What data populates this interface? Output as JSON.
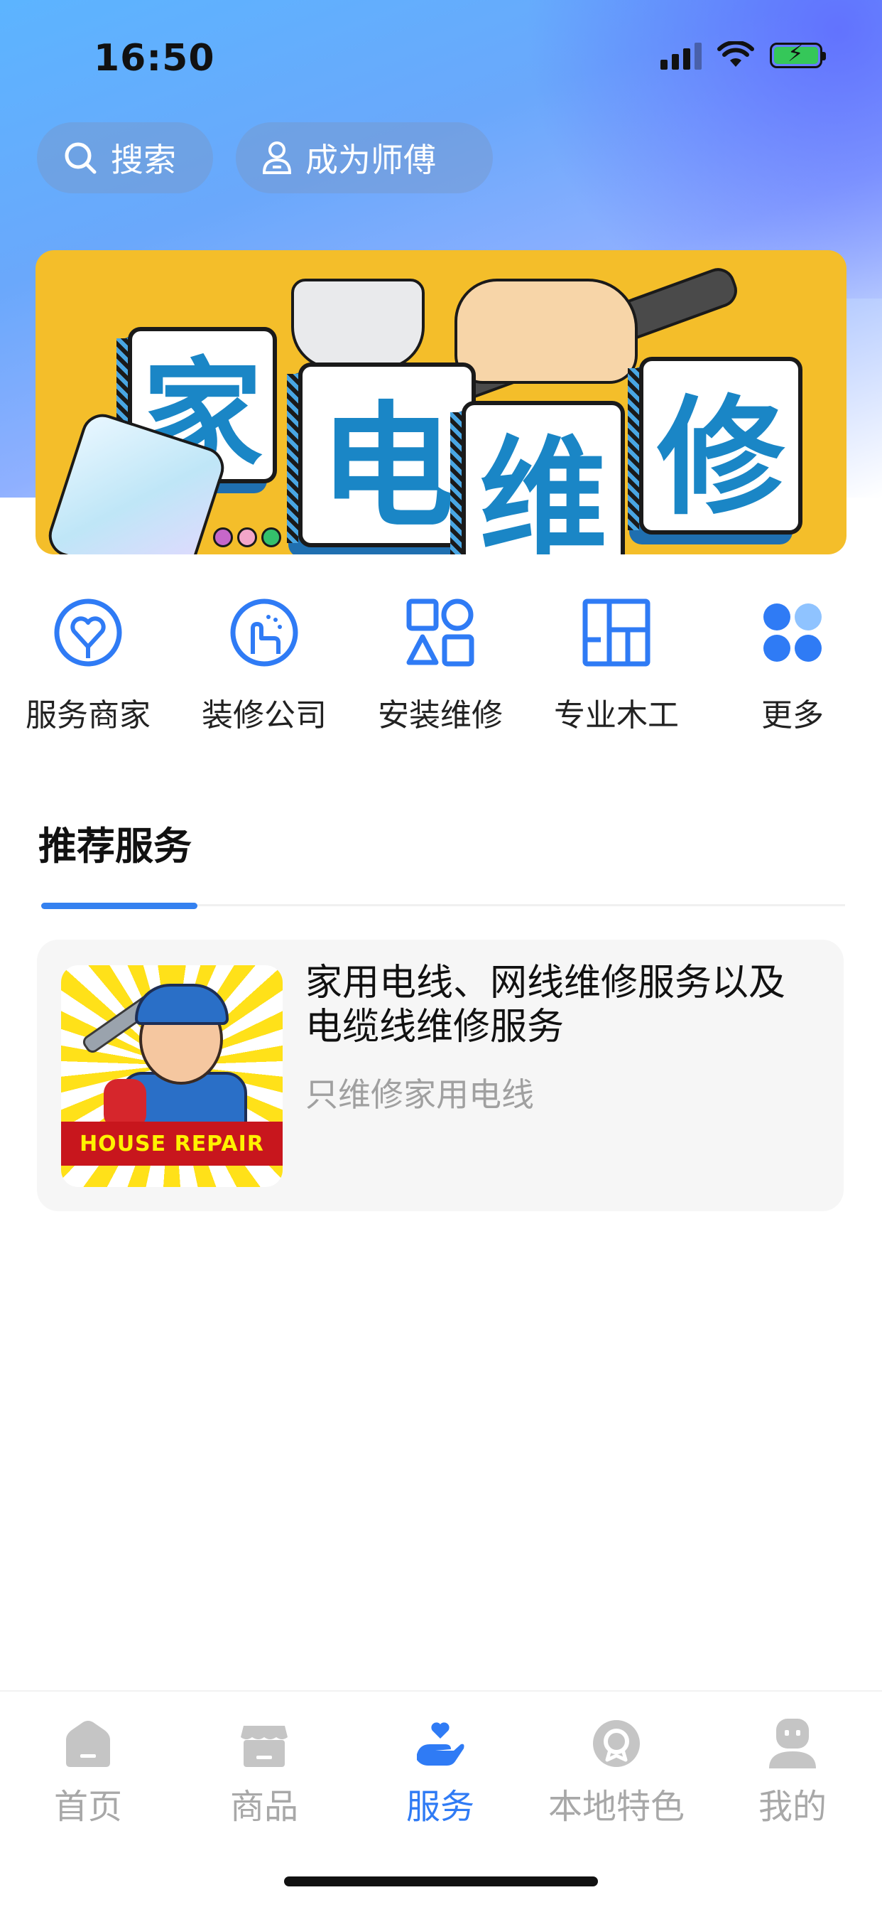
{
  "status_bar": {
    "time": "16:50"
  },
  "top_buttons": {
    "search_label": "搜索",
    "become_master_label": "成为师傅"
  },
  "banner": {
    "chars": [
      "家",
      "电",
      "维",
      "修"
    ]
  },
  "categories": [
    {
      "label": "服务商家",
      "icon": "merchant-heart-icon"
    },
    {
      "label": "装修公司",
      "icon": "renovation-hand-icon"
    },
    {
      "label": "安装维修",
      "icon": "shapes-grid-icon"
    },
    {
      "label": "专业木工",
      "icon": "floorplan-icon"
    },
    {
      "label": "更多",
      "icon": "more-clover-icon"
    }
  ],
  "section": {
    "title": "推荐服务"
  },
  "service_card": {
    "title": "家用电线、网线维修服务以及电缆线维修服务",
    "subtitle": "只维修家用电线",
    "thumb_ribbon": "HOUSE REPAIR"
  },
  "tabbar": {
    "active": "服务",
    "items": [
      {
        "label": "首页",
        "icon": "home-icon"
      },
      {
        "label": "商品",
        "icon": "shop-icon"
      },
      {
        "label": "服务",
        "icon": "service-hand-icon"
      },
      {
        "label": "本地特色",
        "icon": "badge-icon"
      },
      {
        "label": "我的",
        "icon": "profile-robot-icon"
      }
    ]
  },
  "colors": {
    "accent": "#3481f0",
    "banner_bg": "#f4be2a",
    "tab_inactive": "#a8a8a8"
  }
}
